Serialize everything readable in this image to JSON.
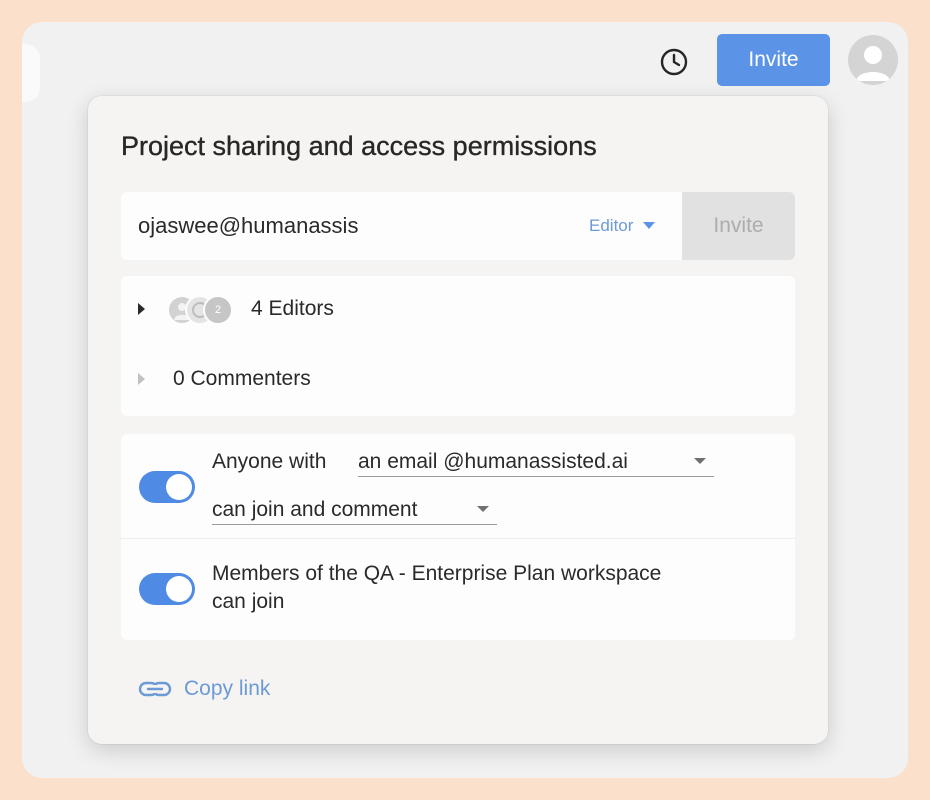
{
  "header": {
    "invite_label": "Invite",
    "history_icon": "clock-icon",
    "avatar_icon": "user-avatar-icon"
  },
  "dialog": {
    "title": "Project sharing and access permissions",
    "email_input": {
      "value": "ojaswee@humanassis",
      "placeholder": ""
    },
    "role_select": {
      "selected": "Editor"
    },
    "invite_label": "Invite"
  },
  "members": {
    "editors": {
      "label": "4 Editors",
      "extra_badge": "2"
    },
    "commenters": {
      "label": "0 Commenters"
    }
  },
  "settings": {
    "email_domain": {
      "enabled": true,
      "prefix": "Anyone with",
      "domain_value": "an email @humanassisted.ai",
      "permission_value": "can join and comment"
    },
    "workspace": {
      "enabled": true,
      "line1": "Members of the QA - Enterprise Plan workspace",
      "line2": "can join"
    }
  },
  "copy_link": {
    "label": "Copy link",
    "icon": "link-icon"
  },
  "colors": {
    "accent": "#5b93e6",
    "toggle": "#4f8ae5",
    "link": "#6b9ad6",
    "page_border": "#fbe0cc",
    "disabled_button": "#e1e1e1"
  }
}
